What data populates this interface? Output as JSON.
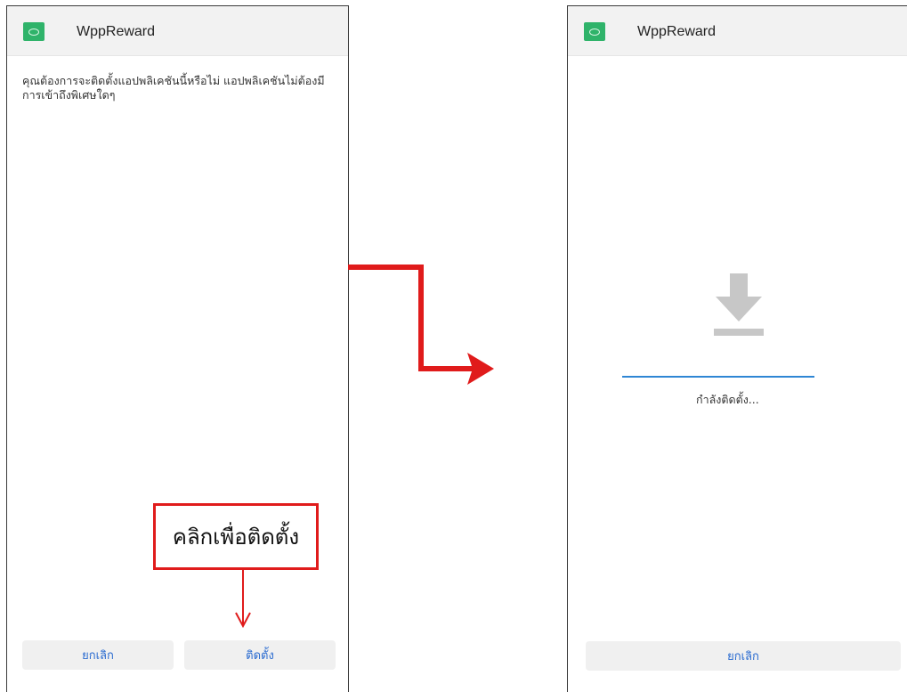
{
  "left_screen": {
    "app_title": "WppReward",
    "prompt_text": "คุณต้องการจะติดตั้งแอปพลิเคชันนี้หรือไม่ แอปพลิเคชันไม่ต้องมีการเข้าถึงพิเศษใดๆ",
    "cancel_label": "ยกเลิก",
    "install_label": "ติดตั้ง",
    "callout_text": "คลิกเพื่อติดตั้ง"
  },
  "right_screen": {
    "app_title": "WppReward",
    "status_text": "กำลังติดตั้ง...",
    "cancel_label": "ยกเลิก"
  },
  "icons": {
    "app_icon": "app-logo-icon",
    "download_icon": "download-arrow-icon",
    "flow_arrow": "red-right-arrow",
    "callout_arrow": "red-down-arrow"
  },
  "colors": {
    "accent": "#e01b1b",
    "button_text": "#2a6bd0",
    "progress": "#2f86d4",
    "app_icon_bg": "#2fb36a"
  }
}
